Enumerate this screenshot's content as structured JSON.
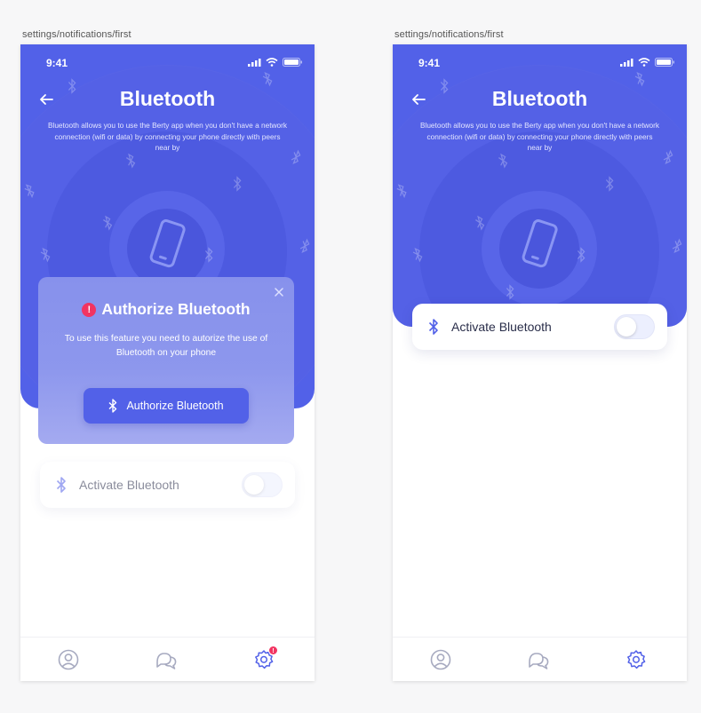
{
  "frames": [
    {
      "label": "settings/notifications/first",
      "status_time": "9:41",
      "title": "Bluetooth",
      "description": "Bluetooth allows you to use the Berty app when you don't have a network connection (wifi or data) by connecting your phone directly with peers near by",
      "modal": {
        "title": "Authorize Bluetooth",
        "warning_glyph": "!",
        "text": "To use this feature you need to autorize the use of Bluetooth on your phone",
        "button_label": "Authorize Bluetooth"
      },
      "toggle_row": {
        "label": "Activate Bluetooth",
        "enabled": false
      },
      "tabs": [
        {
          "icon": "account-icon"
        },
        {
          "icon": "messages-icon"
        },
        {
          "icon": "settings-icon",
          "badge": "!"
        }
      ]
    },
    {
      "label": "settings/notifications/first",
      "status_time": "9:41",
      "title": "Bluetooth",
      "description": "Bluetooth allows you to use the Berty app when you don't have a network connection (wifi or data) by connecting your phone directly with peers near by",
      "toggle_row": {
        "label": "Activate Bluetooth",
        "enabled": false
      },
      "tabs": [
        {
          "icon": "account-icon"
        },
        {
          "icon": "messages-icon"
        },
        {
          "icon": "settings-icon"
        }
      ]
    }
  ],
  "colors": {
    "primary": "#5261e8",
    "alert": "#f23461",
    "tab_inactive": "#a7aac0"
  }
}
